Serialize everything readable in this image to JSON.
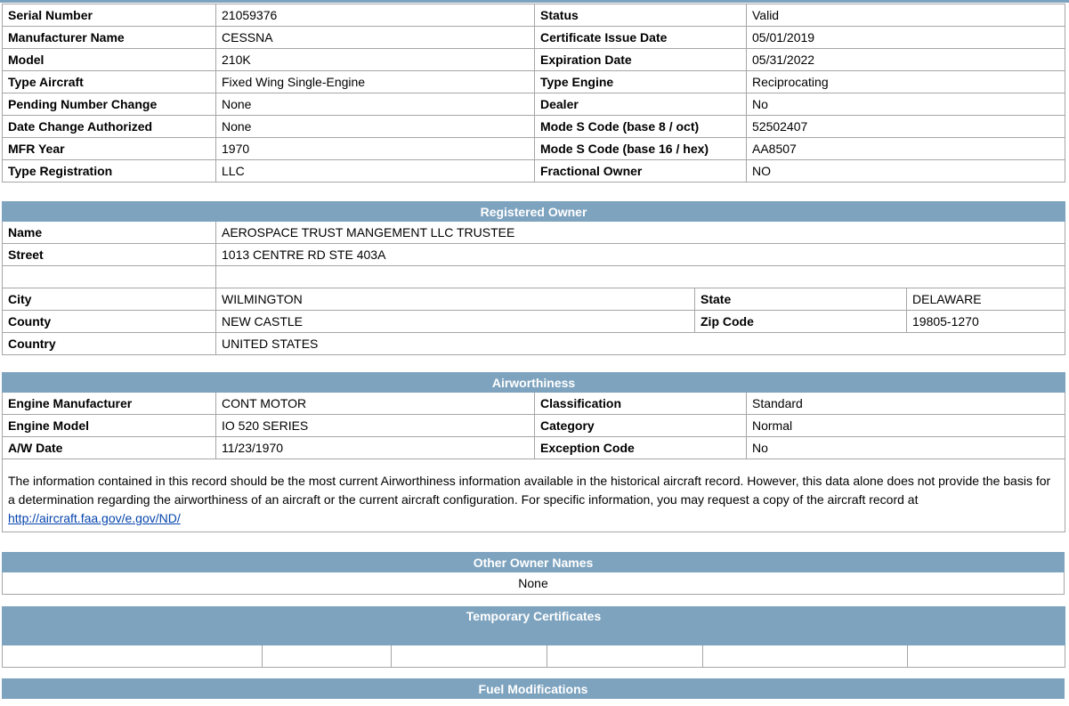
{
  "aircraft": {
    "rows": [
      {
        "l1": "Serial Number",
        "v1": "21059376",
        "l2": "Status",
        "v2": "Valid"
      },
      {
        "l1": "Manufacturer Name",
        "v1": "CESSNA",
        "l2": "Certificate Issue Date",
        "v2": "05/01/2019"
      },
      {
        "l1": "Model",
        "v1": "210K",
        "l2": "Expiration Date",
        "v2": "05/31/2022"
      },
      {
        "l1": "Type Aircraft",
        "v1": "Fixed Wing Single-Engine",
        "l2": "Type Engine",
        "v2": "Reciprocating"
      },
      {
        "l1": "Pending Number Change",
        "v1": "None",
        "l2": "Dealer",
        "v2": "No"
      },
      {
        "l1": "Date Change Authorized",
        "v1": "None",
        "l2": "Mode S Code (base 8 / oct)",
        "v2": "52502407"
      },
      {
        "l1": "MFR Year",
        "v1": "1970",
        "l2": "Mode S Code (base 16 / hex)",
        "v2": "AA8507"
      },
      {
        "l1": "Type Registration",
        "v1": "LLC",
        "l2": "Fractional Owner",
        "v2": "NO"
      }
    ]
  },
  "owner": {
    "title": "Registered Owner",
    "name_label": "Name",
    "name": "AEROSPACE TRUST MANGEMENT LLC TRUSTEE",
    "street_label": "Street",
    "street": "1013 CENTRE RD STE 403A",
    "street2": "",
    "city_label": "City",
    "city": "WILMINGTON",
    "state_label": "State",
    "state": "DELAWARE",
    "county_label": "County",
    "county": "NEW CASTLE",
    "zip_label": "Zip Code",
    "zip": "19805-1270",
    "country_label": "Country",
    "country": "UNITED STATES"
  },
  "airworthiness": {
    "title": "Airworthiness",
    "rows": [
      {
        "l1": "Engine Manufacturer",
        "v1": "CONT MOTOR",
        "l2": "Classification",
        "v2": "Standard"
      },
      {
        "l1": "Engine Model",
        "v1": "IO 520 SERIES",
        "l2": "Category",
        "v2": "Normal"
      },
      {
        "l1": "A/W Date",
        "v1": "11/23/1970",
        "l2": "Exception Code",
        "v2": "No"
      }
    ],
    "note": "The information contained in this record should be the most current Airworthiness information available in the historical aircraft record. However, this data alone does not provide the basis for a determination regarding the airworthiness of an aircraft or the current aircraft configuration. For specific information, you may request a copy of the aircraft record at",
    "link": "http://aircraft.faa.gov/e.gov/ND/"
  },
  "other_owners": {
    "title": "Other Owner Names",
    "value": "None"
  },
  "temp_certs": {
    "title": "Temporary Certificates"
  },
  "fuel_mods": {
    "title": "Fuel Modifications"
  },
  "colors": {
    "header_bg": "#7ea3bf",
    "header_text": "#ffffff",
    "link": "#0645ad",
    "border": "#a6a6a6"
  }
}
